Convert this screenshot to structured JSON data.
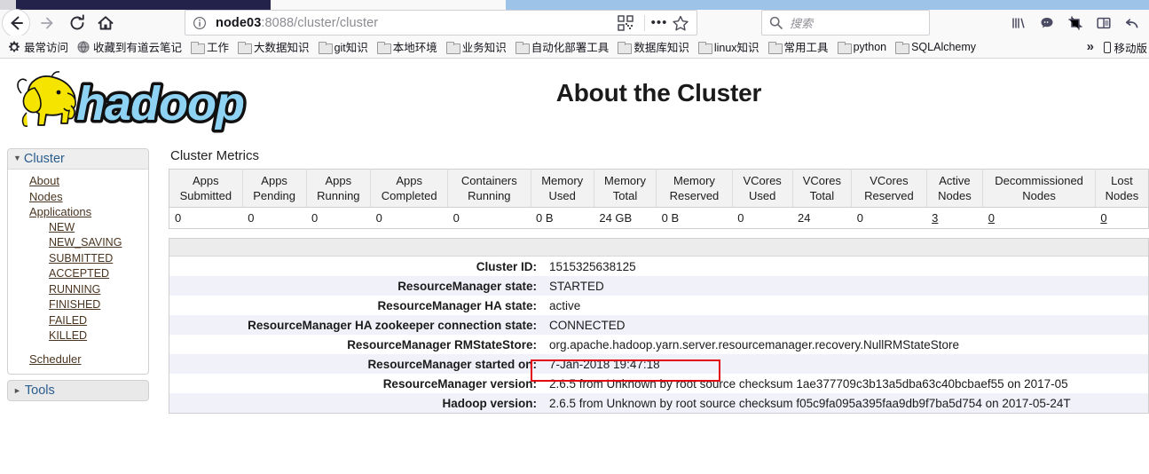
{
  "browser": {
    "nav": {
      "back": "back-arrow-icon",
      "forward": "forward-arrow-icon",
      "reload": "reload-icon",
      "home": "home-icon"
    },
    "url": {
      "host": "node03",
      "rest": ":8088/cluster/cluster",
      "full": "node03:8088/cluster/cluster"
    },
    "search": {
      "placeholder": "搜索"
    },
    "toolbar_icons": [
      "library-icon",
      "pocket-icon",
      "screenshot-icon",
      "reader-view-icon",
      "undo-icon"
    ],
    "bookmarks": [
      {
        "label": "最常访问",
        "icon": "gear-icon"
      },
      {
        "label": "收藏到有道云笔记",
        "icon": "globe-icon"
      },
      {
        "label": "工作",
        "icon": "folder-icon"
      },
      {
        "label": "大数据知识",
        "icon": "folder-icon"
      },
      {
        "label": "git知识",
        "icon": "folder-icon"
      },
      {
        "label": "本地环境",
        "icon": "folder-icon"
      },
      {
        "label": "业务知识",
        "icon": "folder-icon"
      },
      {
        "label": "自动化部署工具",
        "icon": "folder-icon"
      },
      {
        "label": "数据库知识",
        "icon": "folder-icon"
      },
      {
        "label": "linux知识",
        "icon": "folder-icon"
      },
      {
        "label": "常用工具",
        "icon": "folder-icon"
      },
      {
        "label": "python",
        "icon": "folder-icon"
      },
      {
        "label": "SQLAlchemy",
        "icon": "folder-icon"
      }
    ],
    "bookmarks_overflow": "»",
    "mobile_bookmarks": "移动版"
  },
  "page": {
    "logo_alt": "hadoop",
    "title": "About the Cluster",
    "metrics_heading": "Cluster Metrics"
  },
  "sidebar": {
    "cluster": {
      "header": "Cluster",
      "links": [
        {
          "label": "About",
          "level": 1
        },
        {
          "label": "Nodes",
          "level": 1
        },
        {
          "label": "Applications",
          "level": 1
        },
        {
          "label": "NEW",
          "level": 2
        },
        {
          "label": "NEW_SAVING",
          "level": 2
        },
        {
          "label": "SUBMITTED",
          "level": 2
        },
        {
          "label": "ACCEPTED",
          "level": 2
        },
        {
          "label": "RUNNING",
          "level": 2
        },
        {
          "label": "FINISHED",
          "level": 2
        },
        {
          "label": "FAILED",
          "level": 2
        },
        {
          "label": "KILLED",
          "level": 2
        },
        {
          "label": "Scheduler",
          "level": 1,
          "spaced": true
        }
      ]
    },
    "tools": {
      "header": "Tools"
    }
  },
  "cluster_metrics": {
    "columns": [
      "Apps Submitted",
      "Apps Pending",
      "Apps Running",
      "Apps Completed",
      "Containers Running",
      "Memory Used",
      "Memory Total",
      "Memory Reserved",
      "VCores Used",
      "VCores Total",
      "VCores Reserved",
      "Active Nodes",
      "Decommissioned Nodes",
      "Lost Nodes"
    ],
    "values": [
      "0",
      "0",
      "0",
      "0",
      "0",
      "0 B",
      "24 GB",
      "0 B",
      "0",
      "24",
      "0",
      "3",
      "0",
      "0"
    ],
    "linked": [
      false,
      false,
      false,
      false,
      false,
      false,
      false,
      false,
      false,
      false,
      false,
      true,
      true,
      true
    ]
  },
  "cluster_info": {
    "rows": [
      {
        "key": "Cluster ID:",
        "value": "1515325638125"
      },
      {
        "key": "ResourceManager state:",
        "value": "STARTED"
      },
      {
        "key": "ResourceManager HA state:",
        "value": "active",
        "highlighted": true
      },
      {
        "key": "ResourceManager HA zookeeper connection state:",
        "value": "CONNECTED"
      },
      {
        "key": "ResourceManager RMStateStore:",
        "value": "org.apache.hadoop.yarn.server.resourcemanager.recovery.NullRMStateStore"
      },
      {
        "key": "ResourceManager started on:",
        "value": "7-Jan-2018 19:47:18"
      },
      {
        "key": "ResourceManager version:",
        "value": "2.6.5 from Unknown by root source checksum 1ae377709c3b13a5dba63c40bcbaef55 on 2017-05"
      },
      {
        "key": "Hadoop version:",
        "value": "2.6.5 from Unknown by root source checksum f05c9fa095a395faa9db9f7ba5d754 on 2017-05-24T"
      }
    ]
  },
  "colors": {
    "highlight": "#e30613",
    "link": "#4a3520",
    "sidebar_header": "#2a5d8f",
    "row_alt": "#f1f1fa"
  }
}
